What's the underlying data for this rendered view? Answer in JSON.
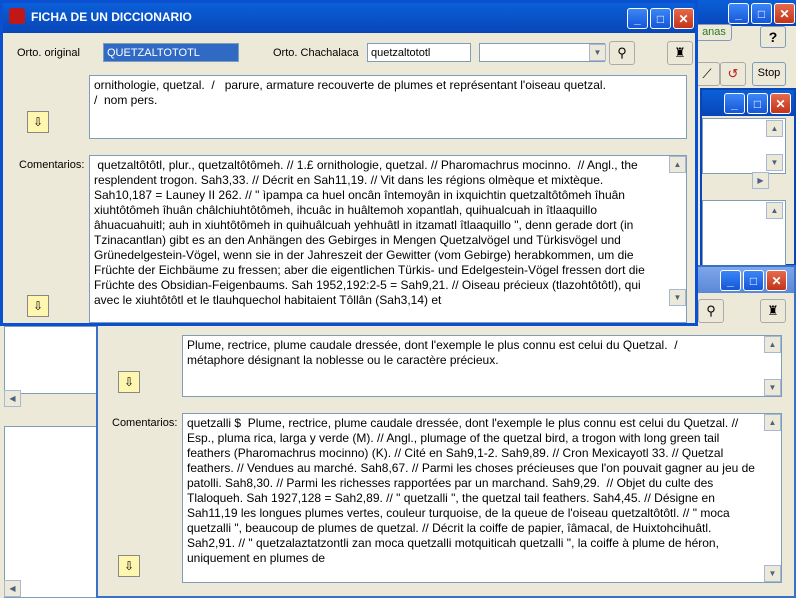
{
  "background_window": {
    "ventanas_label": "anas",
    "help_label": "?",
    "stop_label": "Stop"
  },
  "window1": {
    "title": "FICHA DE UN DICCIONARIO",
    "orto_original_label": "Orto. original",
    "orto_original_value": "QUETZALTOTOTL",
    "orto_chachalaca_label": "Orto. Chachalaca",
    "orto_chachalaca_value": "quetzaltototl",
    "definition": "ornithologie, quetzal.  /   parure, armature recouverte de plumes et représentant l'oiseau quetzal.\n/  nom pers.",
    "comentarios_label": "Comentarios:",
    "comentarios": " quetzaltôtôtl, plur., quetzaltôtômeh. // 1.£ ornithologie, quetzal. // Pharomachrus mocinno.  // Angl., the resplendent trogon. Sah3,33. // Décrit en Sah11,19. // Vit dans les régions olmèque et mixtèque. Sah10,187 = Launey II 262. // \" ìpampa ca huel oncân întemoyân in ixquichtin quetzaltôtômeh îhuân xiuhtôtômeh îhuân châlchiuhtôtômeh, ihcuâc in huâltemoh xopantlah, quihualcuah in îtlaaquillo âhuacuahuitl; auh in xiuhtôtômeh in quihuâlcuah yehhuâtl in itzamatl îtlaaquillo \", denn gerade dort (in Tzinacantlan) gibt es an den Anhängen des Gebirges in Mengen Quetzalvögel und Türkisvögel und Grünedelgestein-Vögel, wenn sie in der Jahreszeit der Gewitter (vom Gebirge) herabkommen, um die Früchte der Eichbäume zu fressen; aber die eigentlichen Türkis- und Edelgestein-Vögel fressen dort die Früchte des Obsidian-Feigenbaums. Sah 1952,192:2-5 = Sah9,21. // Oiseau précieux (tlazohtôtôtl), qui avec le xiuhtôtôtl et le tlauhquechol habitaient Tôllân (Sah3,14) et"
  },
  "window2": {
    "definition": "Plume, rectrice, plume caudale dressée, dont l'exemple le plus connu est celui du Quetzal.  /\nmétaphore désignant la noblesse ou le caractère précieux.",
    "comentarios_label": "Comentarios:",
    "comentarios": "quetzalli $  Plume, rectrice, plume caudale dressée, dont l'exemple le plus connu est celui du Quetzal. // Esp., pluma rica, larga y verde (M). // Angl., plumage of the quetzal bird, a trogon with long green tail feathers (Pharomachrus mocinno) (K). // Cité en Sah9,1-2. Sah9,89. // Cron Mexicayotl 33. // Quetzal feathers. // Vendues au marché. Sah8,67. // Parmi les choses précieuses que l'on pouvait gagner au jeu de patolli. Sah8,30. // Parmi les richesses rapportées par un marchand. Sah9,29.  // Objet du culte des Tlaloqueh. Sah 1927,128 = Sah2,89. // \" quetzalli \", the quetzal tail feathers. Sah4,45. // Désigne en Sah11,19 les longues plumes vertes, couleur turquoise, de la queue de l'oiseau quetzaltôtôtl. // \" moca quetzalli \", beaucoup de plumes de quetzal. // Décrit la coiffe de papier, îâmacal, de Huixtohcihuâtl. Sah2,91. // \" quetzalaztatzontli zan moca quetzalli motquiticah quetzalli \", la coiffe à plume de héron, uniquement en plumes de"
  }
}
